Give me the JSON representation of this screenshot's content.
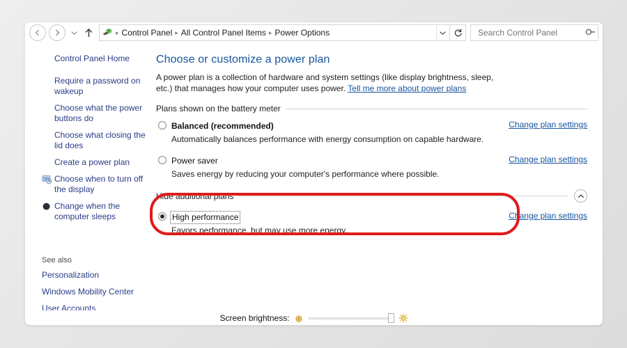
{
  "window": {
    "nav": {
      "back_label": "Back",
      "forward_label": "Forward",
      "recent_label": "Recent pages",
      "up_label": "Up one level",
      "refresh_label": "Refresh",
      "breadcrumbs": [
        "Control Panel",
        "All Control Panel Items",
        "Power Options"
      ],
      "crumb_separator": "▸",
      "address_dropdown_label": "⌄"
    },
    "search": {
      "placeholder": "Search Control Panel",
      "value": "",
      "icon": "search-icon"
    }
  },
  "sidebar": {
    "home_label": "Control Panel Home",
    "items": [
      {
        "label": "Require a password on wakeup",
        "icon": ""
      },
      {
        "label": "Choose what the power buttons do",
        "icon": ""
      },
      {
        "label": "Choose what closing the lid does",
        "icon": ""
      },
      {
        "label": "Create a power plan",
        "icon": ""
      },
      {
        "label": "Choose when to turn off the display",
        "icon": "display-clock-icon"
      },
      {
        "label": "Change when the computer sleeps",
        "icon": "sleep-moon-icon"
      }
    ],
    "see_also": {
      "title": "See also",
      "items": [
        "Personalization",
        "Windows Mobility Center",
        "User Accounts"
      ]
    }
  },
  "main": {
    "heading": "Choose or customize a power plan",
    "description_part1": "A power plan is a collection of hardware and system settings (like display brightness, sleep, etc.) that manages how your computer uses power. ",
    "description_link": "Tell me more about power plans",
    "help_label": "?",
    "group_battery": {
      "label": "Plans shown on the battery meter"
    },
    "group_additional": {
      "label": "Hide additional plans",
      "chevron": "˄"
    },
    "change_link_label": "Change plan settings",
    "plans": [
      {
        "name": "Balanced (recommended)",
        "description": "Automatically balances performance with energy consumption on capable hardware.",
        "selected": false,
        "bold": true,
        "focused": false,
        "link": "Change plan settings"
      },
      {
        "name": "Power saver",
        "description": "Saves energy by reducing your computer's performance where possible.",
        "selected": false,
        "bold": false,
        "focused": false,
        "link": "Change plan settings"
      }
    ],
    "additional_plans": [
      {
        "name": "High performance",
        "description": "Favors performance, but may use more energy.",
        "selected": true,
        "bold": false,
        "focused": true,
        "link": "Change plan settings"
      }
    ]
  },
  "brightness": {
    "label": "Screen brightness:",
    "dim_icon": "dim-sun-icon",
    "bright_icon": "bright-sun-icon",
    "value_percent": 95
  },
  "annotation": {
    "color": "#e01b1b",
    "shape": "ellipse",
    "target": "High performance"
  },
  "colors": {
    "link": "#16549e",
    "sidebar_link": "#2a3c87",
    "heading": "#16549e",
    "annotation_red": "#e01b1b",
    "help_blue": "#2d7dd2"
  }
}
